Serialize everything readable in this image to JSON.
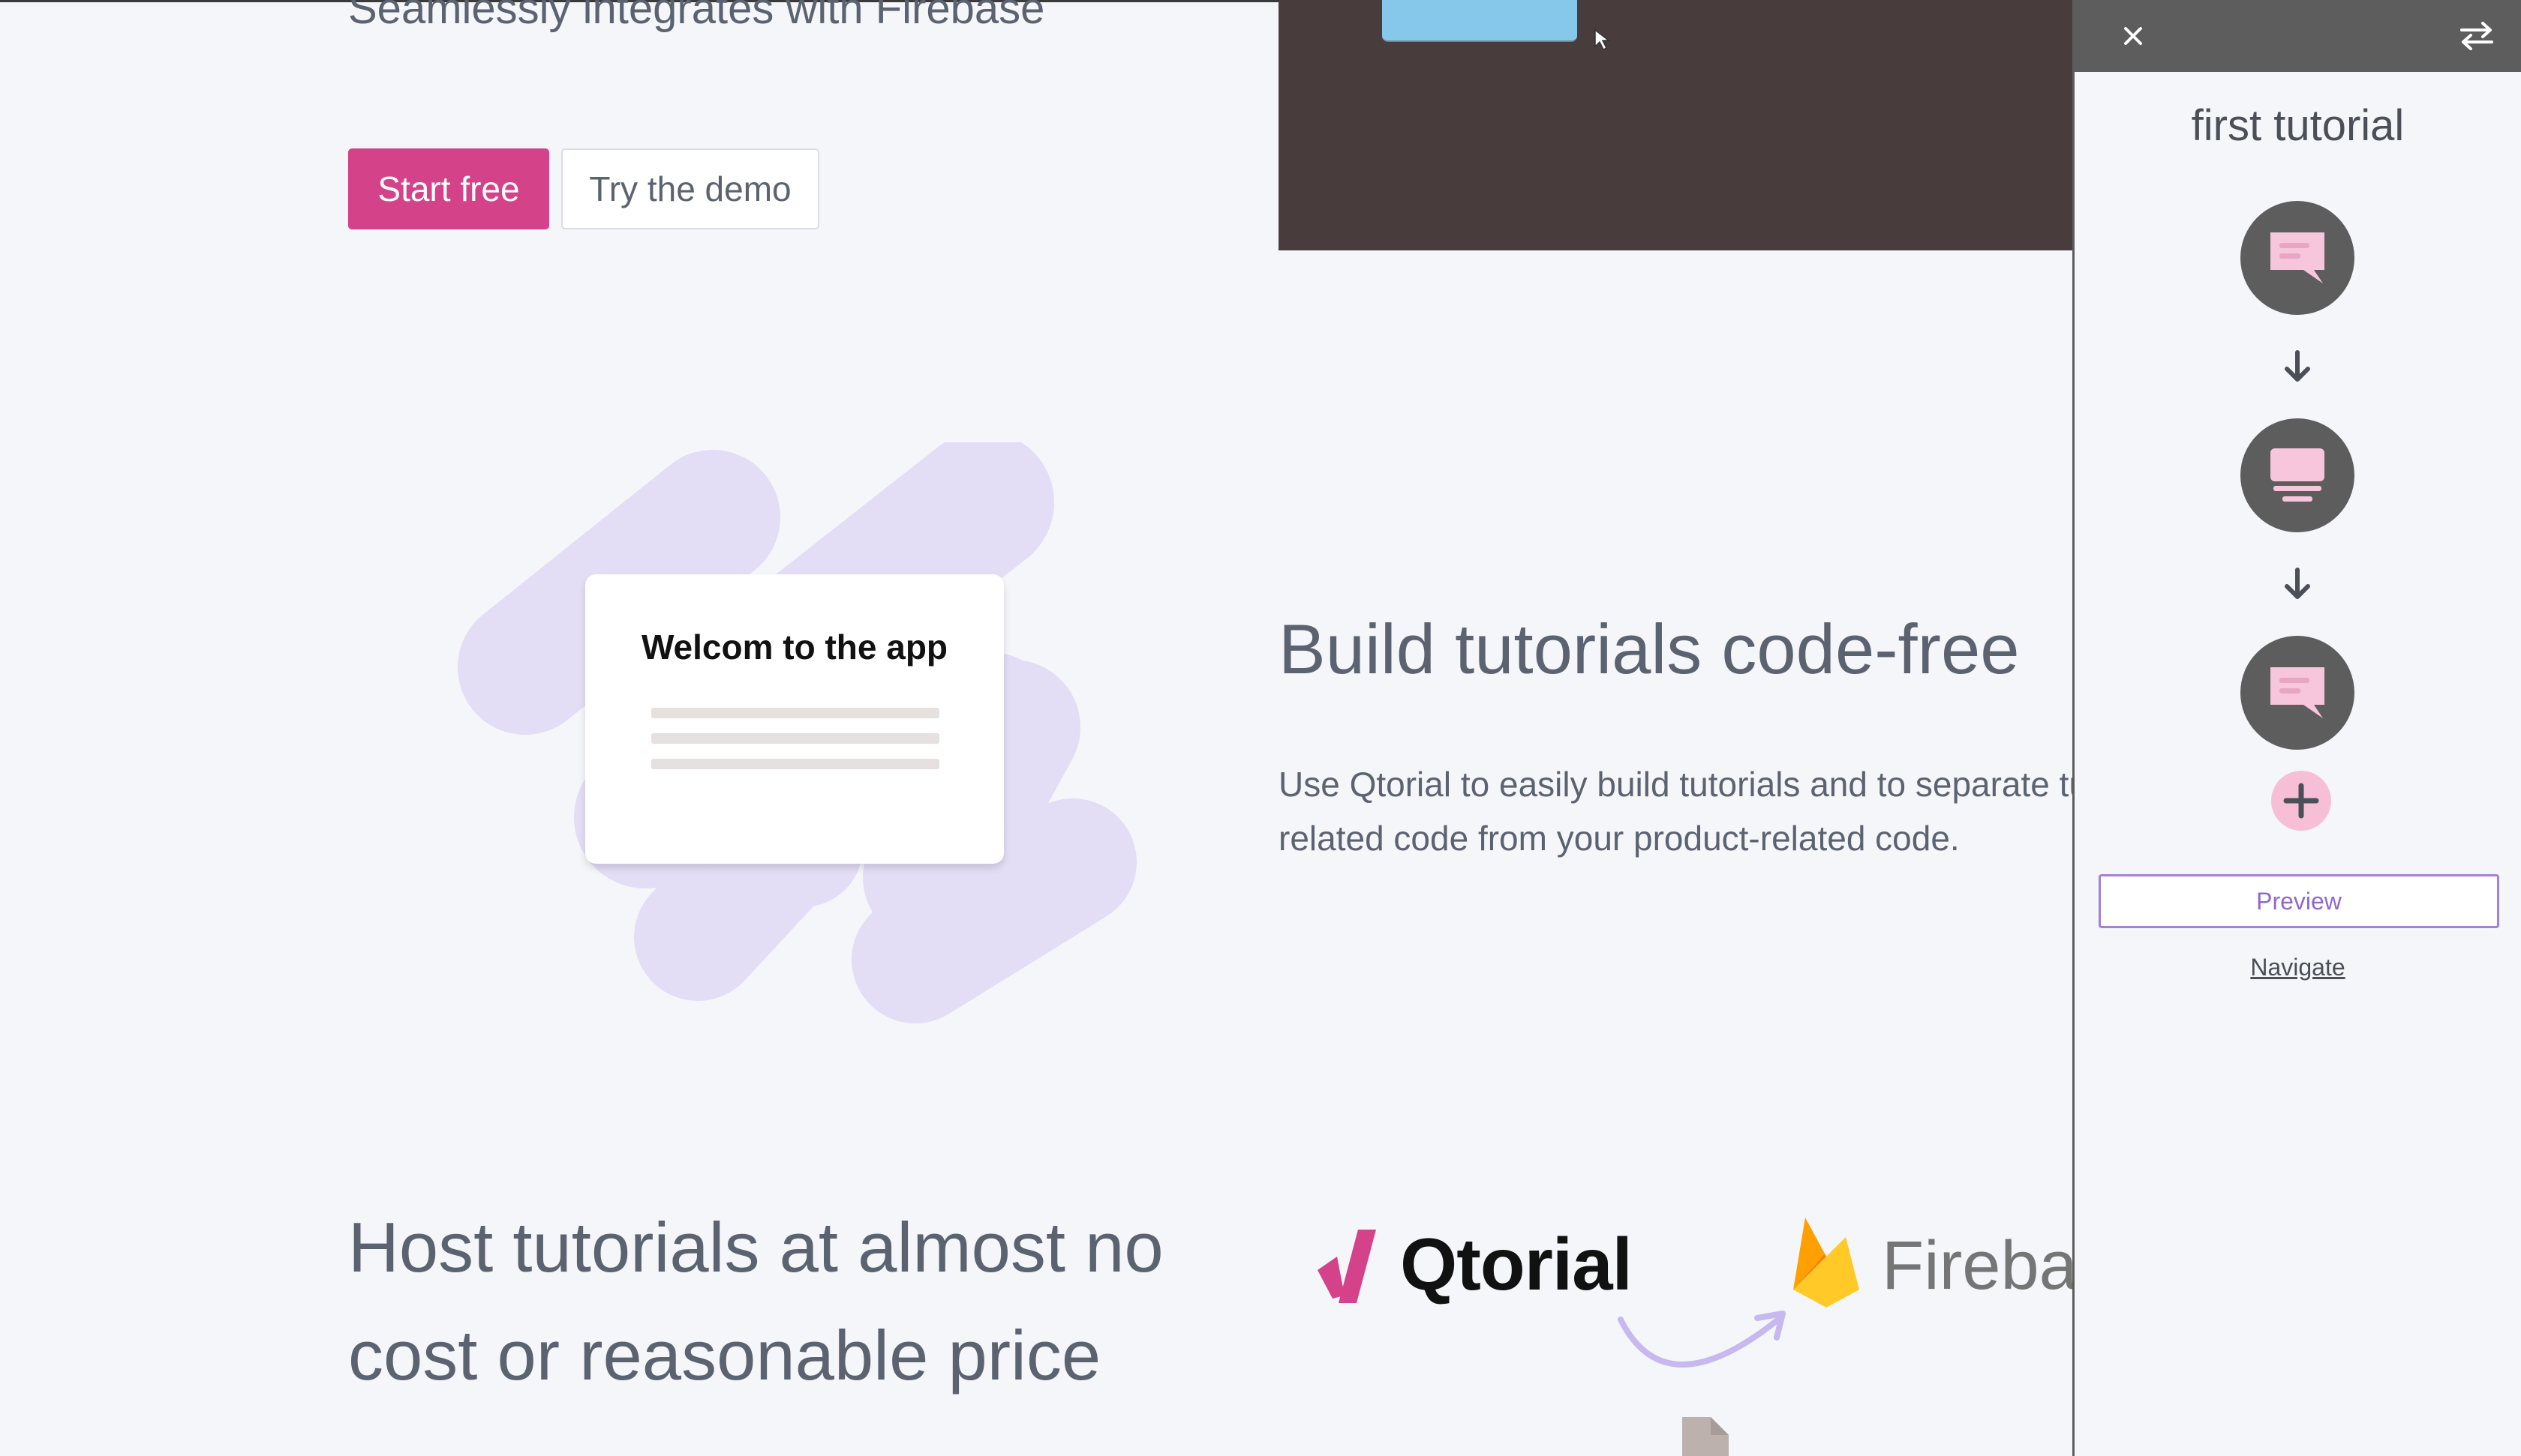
{
  "hero": {
    "tagline": "Seamlessly integrates with Firebase",
    "start_free_label": "Start free",
    "try_demo_label": "Try the demo"
  },
  "illustration": {
    "card_title": "Welcom to the app"
  },
  "build_section": {
    "heading": "Build tutorials code-free",
    "body": "Use Qtorial to easily build tutorials and to separate tutorial-related code from your product-related code."
  },
  "host_section": {
    "heading": "Host tutorials at almost no cost or reasonable price",
    "qtorial_logo_text": "Qtorial",
    "firebase_logo_text": "Firebase"
  },
  "panel": {
    "title": "first tutorial",
    "steps": [
      {
        "icon": "chat-bubble-icon"
      },
      {
        "icon": "modal-icon"
      },
      {
        "icon": "chat-bubble-icon"
      }
    ],
    "preview_label": "Preview",
    "navigate_label": "Navigate"
  },
  "colors": {
    "primary": "#d4428a",
    "panel_header": "#5d5d5d",
    "preview_accent": "#a47fdc",
    "blob": "#e3ddf5",
    "step_icon": "#f7c6dc",
    "firebase_orange": "#f5820d",
    "firebase_yellow": "#ffca28"
  }
}
